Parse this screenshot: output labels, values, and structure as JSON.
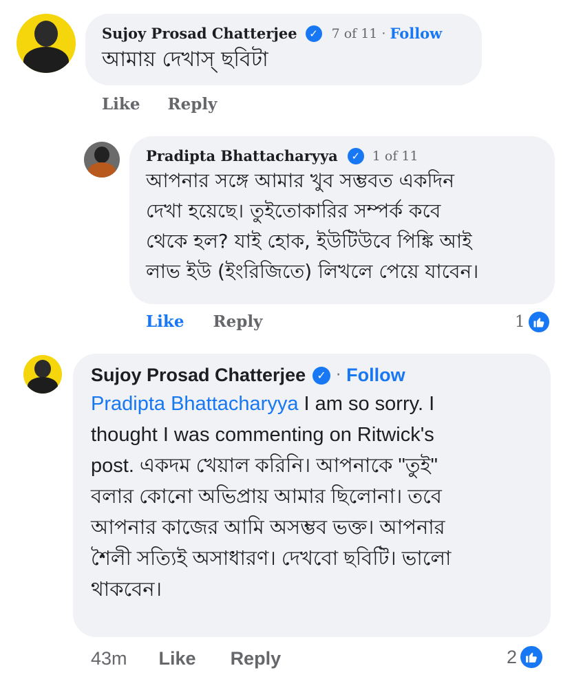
{
  "comments": [
    {
      "author": "Sujoy Prosad Chatterjee",
      "badge": "7 of 11",
      "separator": "·",
      "follow": "Follow",
      "text": "আমায় দেখাস্ ছবিটা",
      "actions": {
        "like": "Like",
        "reply": "Reply"
      }
    },
    {
      "author": "Pradipta Bhattacharyya",
      "badge": "1 of 11",
      "lines": [
        "আপনার সঙ্গে আমার খুব সম্ভবত একদিন",
        "দেখা হয়েছে। তুইতোকারির সম্পর্ক কবে",
        "থেকে হল? যাই হোক, ইউটিউবে পিঙ্কি  আই",
        "লাভ ইউ (ইংরিজিতে) লিখলে পেয়ে যাবেন।"
      ],
      "actions": {
        "like": "Like",
        "reply": "Reply"
      },
      "reaction_count": "1"
    },
    {
      "author": "Sujoy Prosad Chatterjee",
      "separator": "·",
      "follow": "Follow",
      "mention": "Pradipta Bhattacharyya",
      "lines": [
        " I am so sorry. I",
        "thought I was commenting on Ritwick's",
        "post. একদম খেয়াল করিনি। আপনাকে \"তুই\"",
        "বলার কোনো অভিপ্রায় আমার ছিলোনা। তবে",
        "আপনার কাজের আমি অসম্ভব ভক্ত। আপনার",
        "শৈলী সত্যিই অসাধারণ। দেখবো ছবিটি। ভালো",
        "থাকবেন।"
      ],
      "actions": {
        "time": "43m",
        "like": "Like",
        "reply": "Reply"
      },
      "reaction_count": "2"
    }
  ],
  "icons": {
    "verified": "verified-check-icon",
    "like": "thumbs-up-icon"
  },
  "colors": {
    "accent": "#1877f2",
    "bubble": "#f0f2f5",
    "avatar_bg": "#f5d60c"
  }
}
